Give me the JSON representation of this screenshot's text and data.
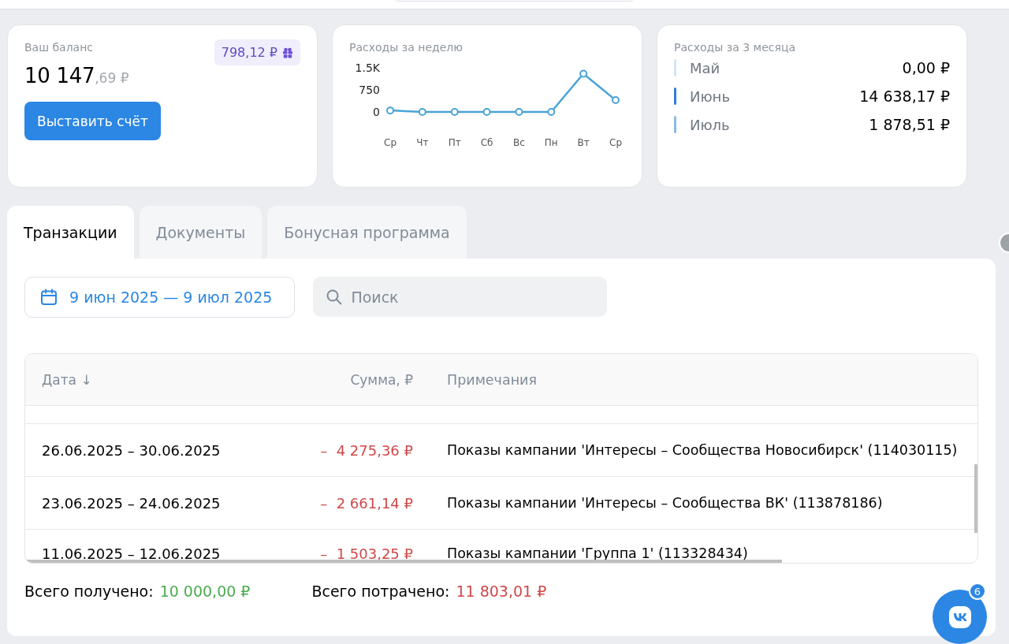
{
  "balance": {
    "label": "Ваш баланс",
    "integer": "10 147",
    "fraction": ",69 ₽",
    "bonus": "798,12 ₽",
    "button": "Выставить счёт"
  },
  "weekly": {
    "title": "Расходы за неделю",
    "chart_data": {
      "type": "line",
      "categories": [
        "Ср",
        "Чт",
        "Пт",
        "Сб",
        "Вс",
        "Пн",
        "Вт",
        "Ср"
      ],
      "series": [
        {
          "color": "#4aa3d6",
          "marker": "circle",
          "values": [
            50,
            0,
            0,
            0,
            0,
            0,
            1300,
            400
          ]
        }
      ],
      "ylim": [
        0,
        1500
      ],
      "yticks": [
        0,
        750,
        {
          "value": 1500,
          "label": "1.5K"
        }
      ]
    }
  },
  "monthly": {
    "title": "Расходы за 3 месяца",
    "items": [
      {
        "month": "Май",
        "amount": "0,00 ₽",
        "color": "#d4e3f5"
      },
      {
        "month": "Июнь",
        "amount": "14 638,17 ₽",
        "color": "#2f7fd6"
      },
      {
        "month": "Июль",
        "amount": "1 878,51 ₽",
        "color": "#8bbbe6"
      }
    ]
  },
  "tabs": [
    {
      "label": "Транзакции",
      "selected": true
    },
    {
      "label": "Документы",
      "selected": false
    },
    {
      "label": "Бонусная программа",
      "selected": false
    }
  ],
  "date_range": "9 июн 2025 — 9 июл 2025",
  "search": {
    "placeholder": "Поиск"
  },
  "table": {
    "columns": [
      "Дата ↓",
      "Сумма, ₽",
      "Примечания"
    ],
    "rows": [
      {
        "date": "26.06.2025 – 30.06.2025",
        "amount": "–  4 275,36 ₽",
        "note": "Показы кампании 'Интересы – Сообщества Новосибирск' (114030115)"
      },
      {
        "date": "23.06.2025 – 24.06.2025",
        "amount": "–  2 661,14 ₽",
        "note": "Показы кампании 'Интересы – Сообщества ВК' (113878186)"
      },
      {
        "date": "11.06.2025 – 12.06.2025",
        "amount": "–  1 503,25 ₽",
        "note": "Показы кампании 'Группа 1' (113328434)"
      }
    ]
  },
  "totals": [
    {
      "label": "Всего получено:",
      "value": "10 000,00 ₽",
      "kind": "received"
    },
    {
      "label": "Всего потрачено:",
      "value": "11 803,01 ₽",
      "kind": "spent"
    }
  ],
  "chat_badge": "6"
}
